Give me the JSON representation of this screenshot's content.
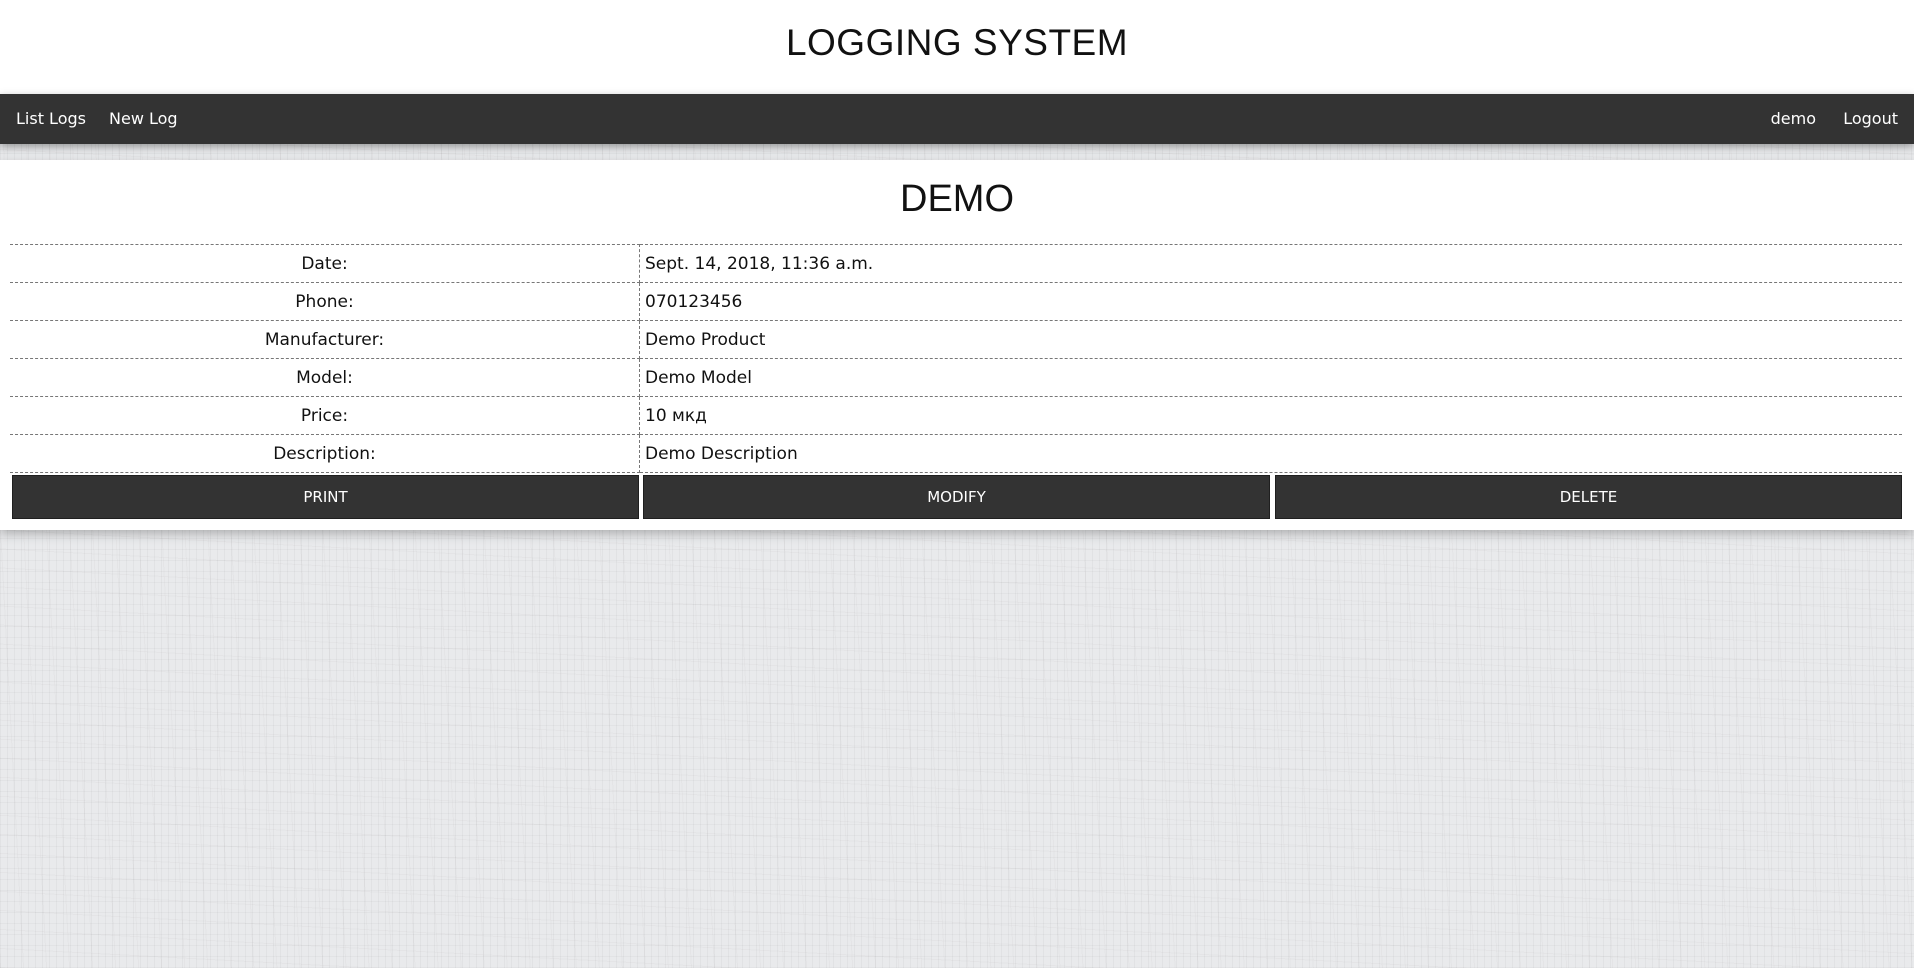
{
  "header": {
    "title": "LOGGING SYSTEM"
  },
  "nav": {
    "left": [
      {
        "label": "List Logs"
      },
      {
        "label": "New Log"
      }
    ],
    "user": "demo",
    "logout": "Logout"
  },
  "record": {
    "title": "DEMO",
    "fields": [
      {
        "label": "Date:",
        "value": "Sept. 14, 2018, 11:36 a.m."
      },
      {
        "label": "Phone:",
        "value": "070123456"
      },
      {
        "label": "Manufacturer:",
        "value": "Demo Product"
      },
      {
        "label": "Model:",
        "value": "Demo Model"
      },
      {
        "label": "Price:",
        "value": "10 мкд"
      },
      {
        "label": "Description:",
        "value": "Demo Description"
      }
    ]
  },
  "actions": {
    "print": "PRINT",
    "modify": "MODIFY",
    "delete": "DELETE"
  },
  "colors": {
    "navbar": "#333333",
    "button": "#333333",
    "background": "#e9eaec"
  }
}
